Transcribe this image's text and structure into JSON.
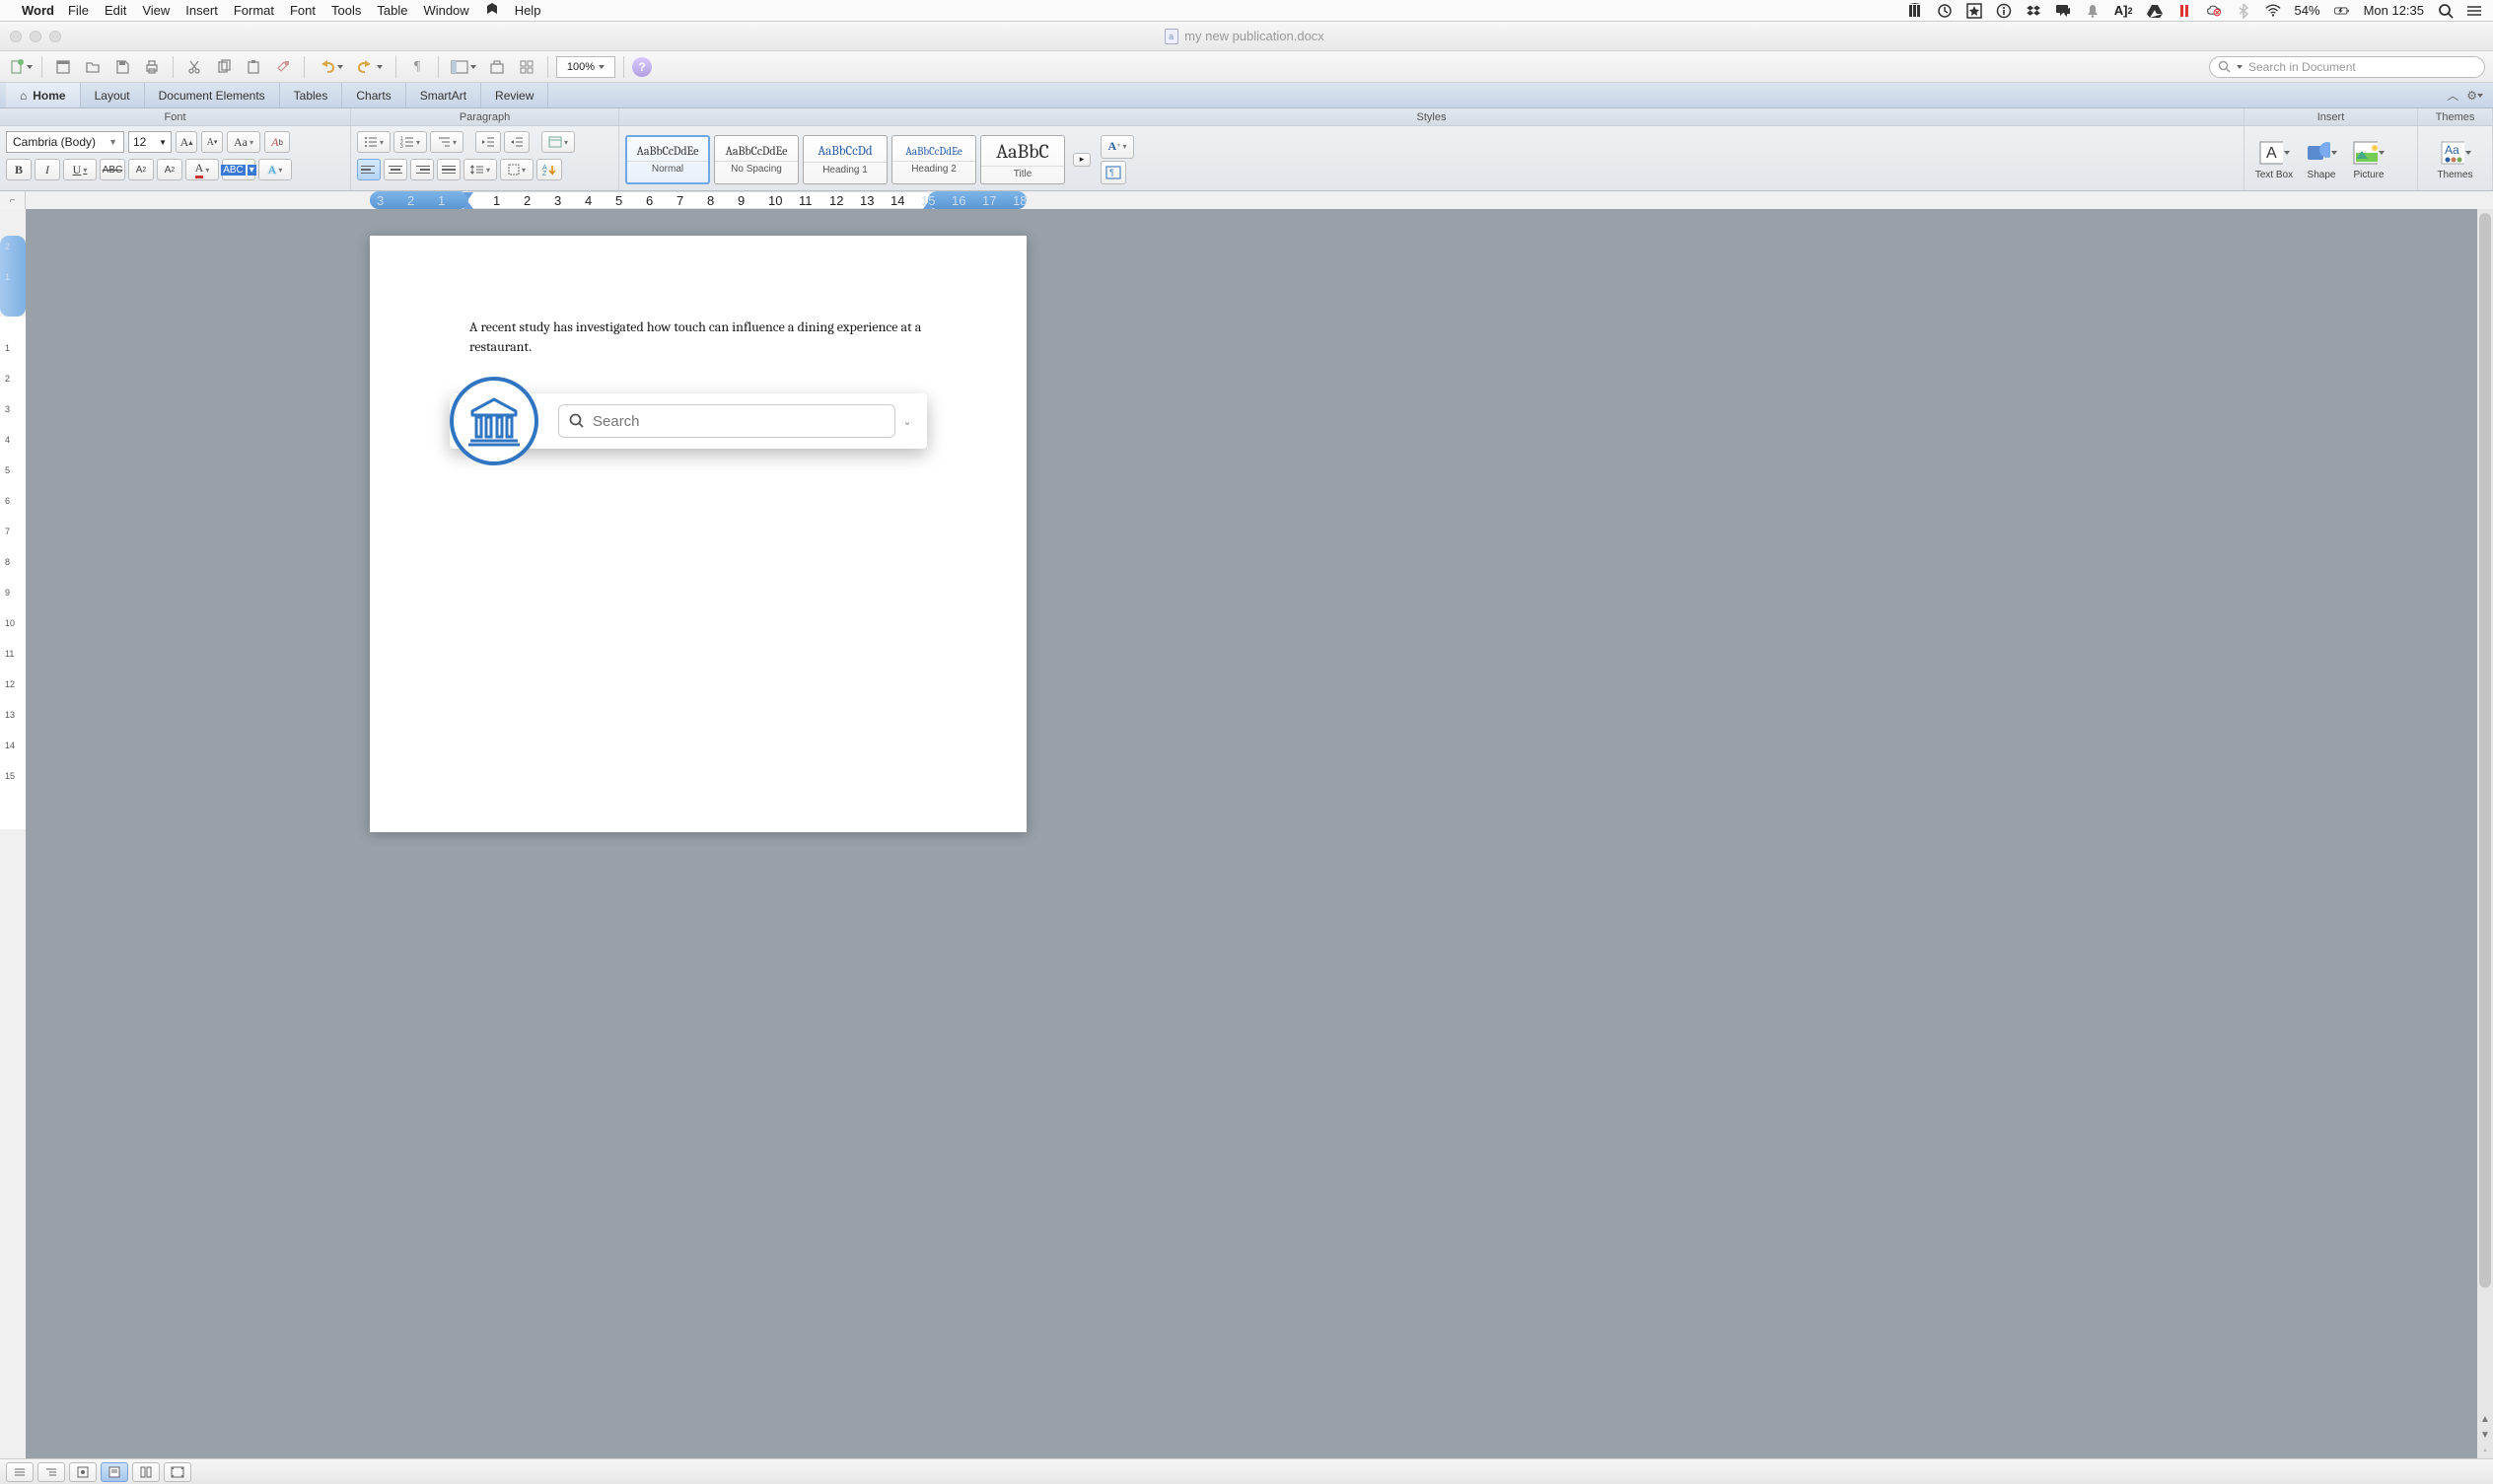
{
  "menubar": {
    "app": "Word",
    "items": [
      "File",
      "Edit",
      "View",
      "Insert",
      "Format",
      "Font",
      "Tools",
      "Table",
      "Window"
    ],
    "help": "Help",
    "battery": "54%",
    "clock": "Mon 12:35"
  },
  "window": {
    "title": "my new publication.docx"
  },
  "qtoolbar": {
    "zoom": "100%",
    "search_placeholder": "Search in Document"
  },
  "ribbon": {
    "tabs": [
      "Home",
      "Layout",
      "Document Elements",
      "Tables",
      "Charts",
      "SmartArt",
      "Review"
    ],
    "active_tab": 0,
    "groups": [
      "Font",
      "Paragraph",
      "Styles",
      "Insert",
      "Themes"
    ],
    "font_name": "Cambria (Body)",
    "font_size": "12",
    "styles": [
      {
        "preview": "AaBbCcDdEe",
        "label": "Normal",
        "cls": ""
      },
      {
        "preview": "AaBbCcDdEe",
        "label": "No Spacing",
        "cls": ""
      },
      {
        "preview": "AaBbCcDd",
        "label": "Heading 1",
        "cls": "blue"
      },
      {
        "preview": "AaBbCcDdEe",
        "label": "Heading 2",
        "cls": "blue"
      },
      {
        "preview": "AaBbC",
        "label": "Title",
        "cls": "big"
      }
    ],
    "insert_items": [
      "Text Box",
      "Shape",
      "Picture"
    ],
    "themes_label": "Themes"
  },
  "hruler": {
    "left_neg": [
      "3",
      "2",
      "1"
    ],
    "nums": [
      "1",
      "2",
      "3",
      "4",
      "5",
      "6",
      "7",
      "8",
      "9",
      "10",
      "11",
      "12",
      "13",
      "14",
      "15",
      "16",
      "17",
      "18"
    ]
  },
  "vruler": {
    "top_neg": [
      "2",
      "1"
    ],
    "nums": [
      "1",
      "2",
      "3",
      "4",
      "5",
      "6",
      "7",
      "8",
      "9",
      "10",
      "11",
      "12",
      "13",
      "14",
      "15"
    ]
  },
  "document": {
    "body_text": "A recent study has investigated how touch can influence a dining experience at a restaurant."
  },
  "overlay": {
    "search_placeholder": "Search"
  }
}
